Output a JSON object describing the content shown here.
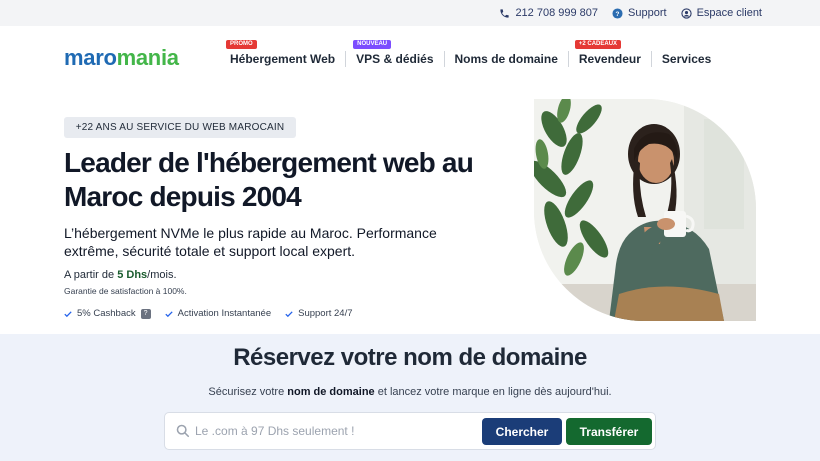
{
  "topbar": {
    "phone": "212 708 999 807",
    "support": "Support",
    "account": "Espace client"
  },
  "header": {
    "logo_part1": "maro",
    "logo_part2": "mania",
    "nav": [
      {
        "label": "Hébergement Web",
        "badge": "PROMO"
      },
      {
        "label": "VPS & dédiés",
        "badge": "NOUVEAU"
      },
      {
        "label": "Noms de domaine",
        "badge": ""
      },
      {
        "label": "Revendeur",
        "badge": "+2 CADEAUX"
      },
      {
        "label": "Services",
        "badge": ""
      }
    ]
  },
  "hero": {
    "chip": "+22 ANS AU SERVICE DU WEB MAROCAIN",
    "title": "Leader de l'hébergement web au Maroc depuis 2004",
    "subtitle": "L’hébergement NVMe le plus rapide au Maroc. Performance extrême, sécurité totale et support local expert.",
    "price_prefix": "A partir de ",
    "price_value": "5 Dhs",
    "price_suffix": "/mois.",
    "guarantee": "Garantie de satisfaction à 100%.",
    "features": [
      "5% Cashback",
      "Activation Instantanée",
      "Support 24/7"
    ],
    "cashback_help": "?"
  },
  "domain": {
    "title": "Réservez votre nom de domaine",
    "text_before": "Sécurisez votre ",
    "text_bold": "nom de domaine",
    "text_after": " et lancez votre marque en ligne dès aujourd'hui.",
    "placeholder": "Le .com à 97 Dhs seulement !",
    "search_button": "Chercher",
    "transfer_button": "Transférer"
  },
  "colors": {
    "brand_blue": "#1f6ab3",
    "brand_green": "#43b649",
    "search_button": "#1b3d78",
    "transfer_button": "#14692f",
    "badge_red": "#e53935",
    "badge_purple": "#7c4dff"
  }
}
